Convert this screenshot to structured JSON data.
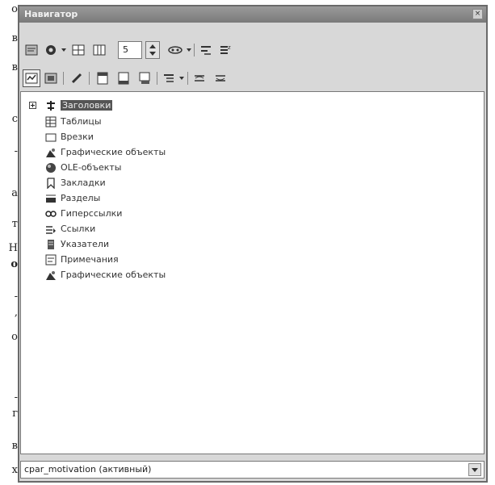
{
  "background_text": [
    "о",
    "в",
    "в",
    "с",
    "-",
    "а",
    "т",
    "Н",
    "о",
    "-",
    ",",
    "о",
    "-",
    "г",
    "в",
    "х"
  ],
  "window": {
    "title": "Навигатор",
    "close_label": "×"
  },
  "toolbar": {
    "headings_number": "5"
  },
  "tree": {
    "items": [
      {
        "label": "Заголовки",
        "icon": "headings-icon",
        "selected": true
      },
      {
        "label": "Таблицы",
        "icon": "tables-icon"
      },
      {
        "label": "Врезки",
        "icon": "frames-icon"
      },
      {
        "label": "Графические объекты",
        "icon": "graphics-icon"
      },
      {
        "label": "OLE-объекты",
        "icon": "ole-objects-icon"
      },
      {
        "label": "Закладки",
        "icon": "bookmarks-icon"
      },
      {
        "label": "Разделы",
        "icon": "sections-icon"
      },
      {
        "label": "Гиперссылки",
        "icon": "hyperlinks-icon"
      },
      {
        "label": "Ссылки",
        "icon": "references-icon"
      },
      {
        "label": "Указатели",
        "icon": "indexes-icon"
      },
      {
        "label": "Примечания",
        "icon": "comments-icon"
      },
      {
        "label": "Графические объекты",
        "icon": "drawing-objects-icon"
      }
    ]
  },
  "document_select": {
    "value": "cpar_motivation (активный)"
  },
  "colors": {
    "title_bar": "#8a8a8a",
    "window_bg": "#d8d8d8",
    "selection": "#555555"
  }
}
